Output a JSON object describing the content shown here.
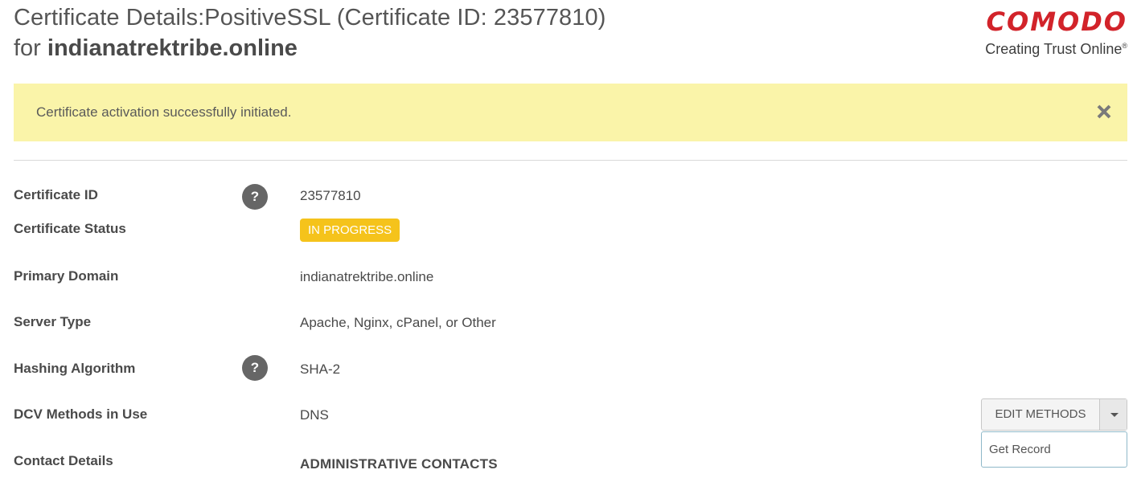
{
  "header": {
    "title_line1": "Certificate Details:PositiveSSL (Certificate ID: 23577810)",
    "title_for": "for",
    "title_domain": "indianatrektribe.online"
  },
  "logo": {
    "word": "COMODO",
    "tagline": "Creating Trust Online",
    "registered_mark": "®",
    "brand_color": "#d2232a"
  },
  "alert": {
    "message": "Certificate activation successfully initiated.",
    "close_icon": "close-icon",
    "background_color": "#faf4a9"
  },
  "details": {
    "certificate_id": {
      "label": "Certificate ID",
      "value": "23577810",
      "help_icon": "help-icon"
    },
    "certificate_status": {
      "label": "Certificate Status",
      "value": "IN PROGRESS",
      "badge_color": "#f5c31b"
    },
    "primary_domain": {
      "label": "Primary Domain",
      "value": "indianatrektribe.online"
    },
    "server_type": {
      "label": "Server Type",
      "value": "Apache, Nginx, cPanel, or Other"
    },
    "hashing_algorithm": {
      "label": "Hashing Algorithm",
      "value": "SHA-2",
      "help_icon": "help-icon"
    },
    "dcv_methods": {
      "label": "DCV Methods in Use",
      "value": "DNS"
    },
    "contact_details": {
      "label": "Contact Details",
      "heading": "ADMINISTRATIVE CONTACTS"
    }
  },
  "dcv_actions": {
    "button_label": "EDIT METHODS",
    "dropdown_items": [
      "Get Record"
    ]
  },
  "help_glyph": "?"
}
